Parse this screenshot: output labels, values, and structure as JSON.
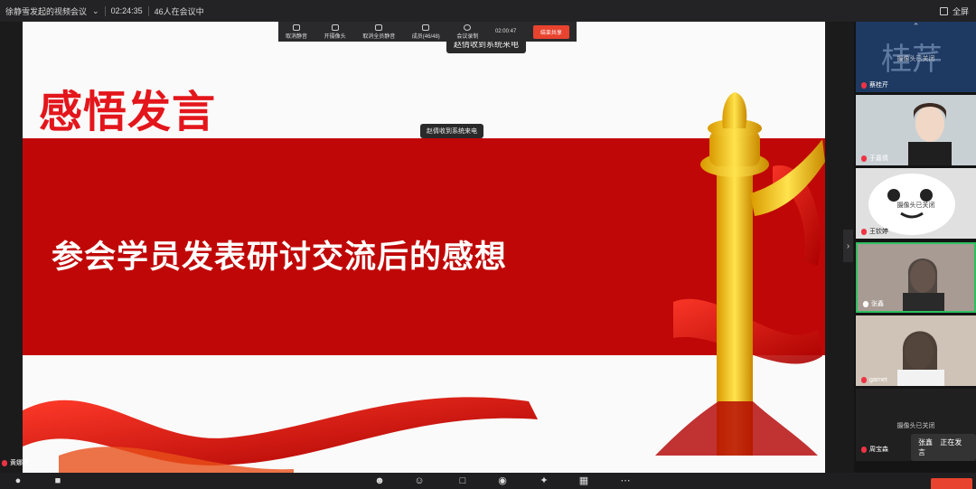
{
  "topbar": {
    "meeting_title": "徐静雪发起的视频会议",
    "elapsed": "02:24:35",
    "participants": "46人在会议中",
    "fullscreen_label": "全屏"
  },
  "mini_toolbar": {
    "items": [
      "取消静音",
      "开摄像头",
      "取消全员静音",
      "成员(46/48)",
      "会议录制"
    ],
    "timer": "02:00:47",
    "end_label": "结束共享"
  },
  "slide": {
    "title": "感悟发言",
    "subtitle": "参会学员发表研讨交流后的感想"
  },
  "tooltips": {
    "top": "赵倩收到系统来电",
    "middle": "赵倩收到系统来电"
  },
  "presenter": {
    "name": "黄娜漫"
  },
  "sidebar": {
    "tiles": [
      {
        "name": "蔡桂芹",
        "cam_off": "摄像头已关闭",
        "avatar_text": "桂芹"
      },
      {
        "name": "于嘉倩"
      },
      {
        "name": "王钦婷",
        "cam_off": "摄像头已关闭"
      },
      {
        "name": "张鑫"
      },
      {
        "name": "garnet"
      },
      {
        "name": "周宝森",
        "cam_off": "摄像头已关闭"
      }
    ]
  },
  "speaking": {
    "name": "张鑫",
    "status": "正在发言"
  },
  "colors": {
    "accent_red": "#c00707",
    "title_red": "#e3161b",
    "end_button": "#e8432e",
    "active_border": "#2fbf5f"
  }
}
